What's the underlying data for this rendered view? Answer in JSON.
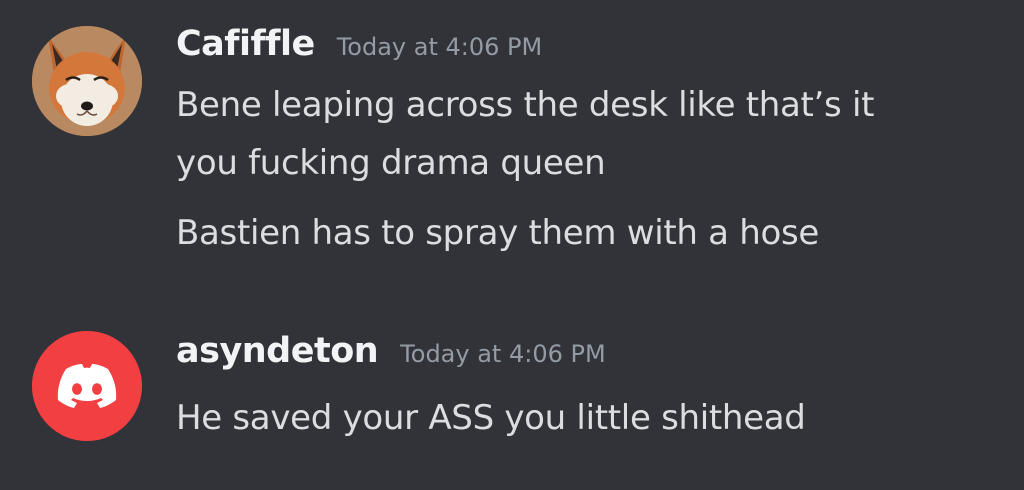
{
  "messages": [
    {
      "author": "Cafiffle",
      "timestamp": "Today at 4:06 PM",
      "avatar_icon": "fox-avatar",
      "lines": [
        "Bene leaping across the desk like that’s it",
        "you fucking drama queen",
        "Bastien has to spray them with a hose"
      ]
    },
    {
      "author": "asyndeton",
      "timestamp": "Today at 4:06 PM",
      "avatar_icon": "discord-default-avatar",
      "avatar_color": "#f23f42",
      "lines": [
        "He saved your ASS you little shithead"
      ]
    }
  ]
}
